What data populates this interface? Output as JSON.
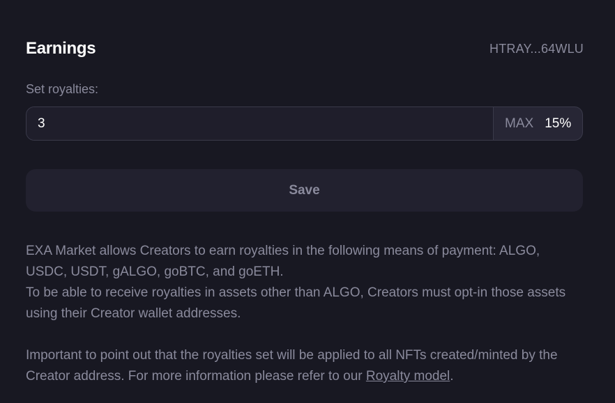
{
  "header": {
    "title": "Earnings",
    "wallet_address": "HTRAY...64WLU"
  },
  "royalties": {
    "label": "Set royalties:",
    "value": "3",
    "max_label": "MAX",
    "max_value": "15%"
  },
  "actions": {
    "save_label": "Save"
  },
  "info": {
    "line_1": "EXA Market allows Creators to earn royalties in the following means of payment: ALGO,",
    "line_2": "USDC, USDT, gALGO, goBTC, and goETH.",
    "line_3": "To be able to receive royalties in assets other than ALGO, Creators must opt-in those assets",
    "line_4": "using their Creator wallet addresses.",
    "line_5": "Important to point out that the royalties set will be applied to all NFTs created/minted by the",
    "line_6_prefix": "Creator address. For more information please refer to our ",
    "link_text": "Royalty model",
    "line_6_suffix": "."
  },
  "colors": {
    "background": "#181822",
    "input_background": "#1f1e2b",
    "button_background": "#22212f",
    "muted_text": "#8a8a9c",
    "primary_text": "#ffffff"
  }
}
